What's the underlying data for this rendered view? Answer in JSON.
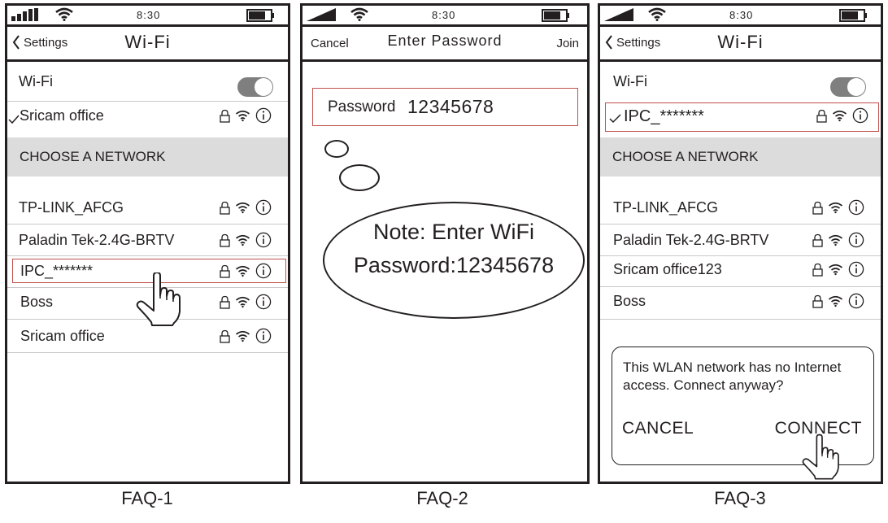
{
  "status_bar": {
    "time": "8:30"
  },
  "faq1": {
    "back_label": "Settings",
    "title": "Wi-Fi",
    "wifi_label": "Wi-Fi",
    "connected_network": "Sricam office",
    "section_header": "CHOOSE A NETWORK",
    "networks": [
      "TP-LINK_AFCG",
      "Paladin Tek-2.4G-BRTV",
      "IPC_*******",
      "Boss",
      "Sricam office"
    ],
    "caption": "FAQ-1"
  },
  "faq2": {
    "cancel_label": "Cancel",
    "title": "Enter Password",
    "join_label": "Join",
    "password_label": "Password",
    "password_value": "12345678",
    "note_line1": "Note: Enter WiFi",
    "note_line2": "Password:12345678",
    "caption": "FAQ-2"
  },
  "faq3": {
    "back_label": "Settings",
    "title": "Wi-Fi",
    "wifi_label": "Wi-Fi",
    "connected_network": "IPC_*******",
    "section_header": "CHOOSE A NETWORK",
    "networks": [
      "TP-LINK_AFCG",
      "Paladin Tek-2.4G-BRTV",
      "Sricam office123",
      "Boss"
    ],
    "dialog_message": "This WLAN network has no Internet access. Connect anyway?",
    "cancel_button": "CANCEL",
    "connect_button": "CONNECT",
    "caption": "FAQ-3"
  },
  "colors": {
    "highlight": "#c0504d",
    "section_bg": "#dcdcdc",
    "toggle": "#7f7f7f"
  },
  "icons": [
    "signal-icon",
    "wifi-icon",
    "battery-icon",
    "lock-icon",
    "info-icon",
    "hand-pointer-icon"
  ]
}
